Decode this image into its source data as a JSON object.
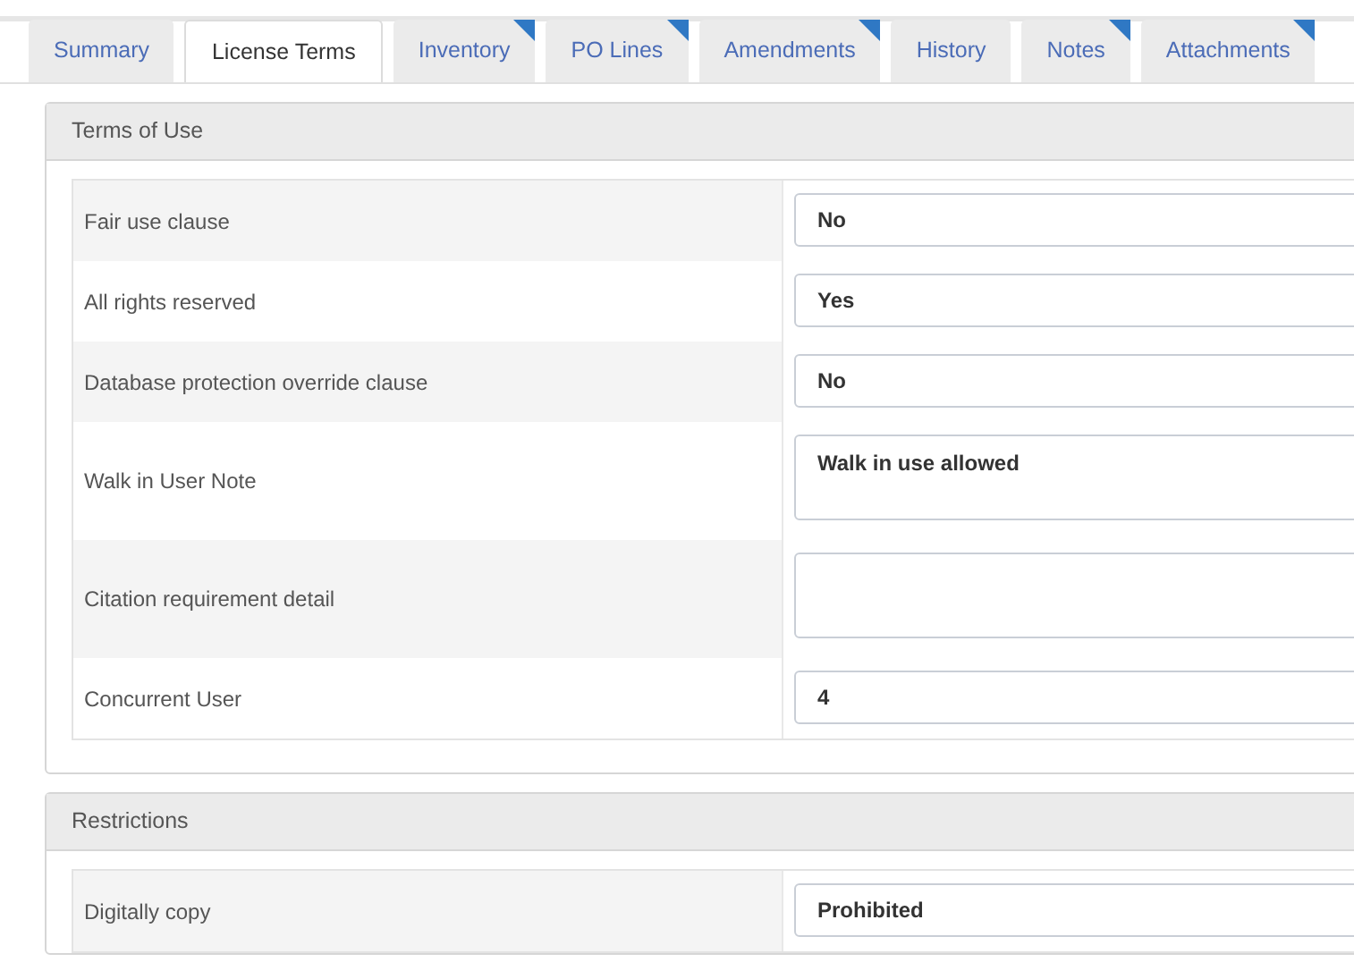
{
  "tabs": [
    {
      "label": "Summary",
      "selected": false,
      "flagged": false
    },
    {
      "label": "License Terms",
      "selected": true,
      "flagged": false
    },
    {
      "label": "Inventory",
      "selected": false,
      "flagged": true
    },
    {
      "label": "PO Lines",
      "selected": false,
      "flagged": true
    },
    {
      "label": "Amendments",
      "selected": false,
      "flagged": true
    },
    {
      "label": "History",
      "selected": false,
      "flagged": false
    },
    {
      "label": "Notes",
      "selected": false,
      "flagged": true
    },
    {
      "label": "Attachments",
      "selected": false,
      "flagged": true
    }
  ],
  "sections": [
    {
      "title": "Terms of Use",
      "rows": [
        {
          "label": "Fair use clause",
          "kind": "text",
          "value": "No"
        },
        {
          "label": "All rights reserved",
          "kind": "text",
          "value": "Yes"
        },
        {
          "label": "Database protection override clause",
          "kind": "text",
          "value": "No"
        },
        {
          "label": "Walk in User Note",
          "kind": "textarea",
          "value": "Walk in use allowed"
        },
        {
          "label": "Citation requirement detail",
          "kind": "textarea"
        },
        {
          "label": "Concurrent User",
          "kind": "text",
          "value": "4"
        }
      ]
    },
    {
      "title": "Restrictions",
      "rows": [
        {
          "label": "Digitally copy",
          "kind": "text",
          "value": "Prohibited"
        }
      ]
    }
  ]
}
